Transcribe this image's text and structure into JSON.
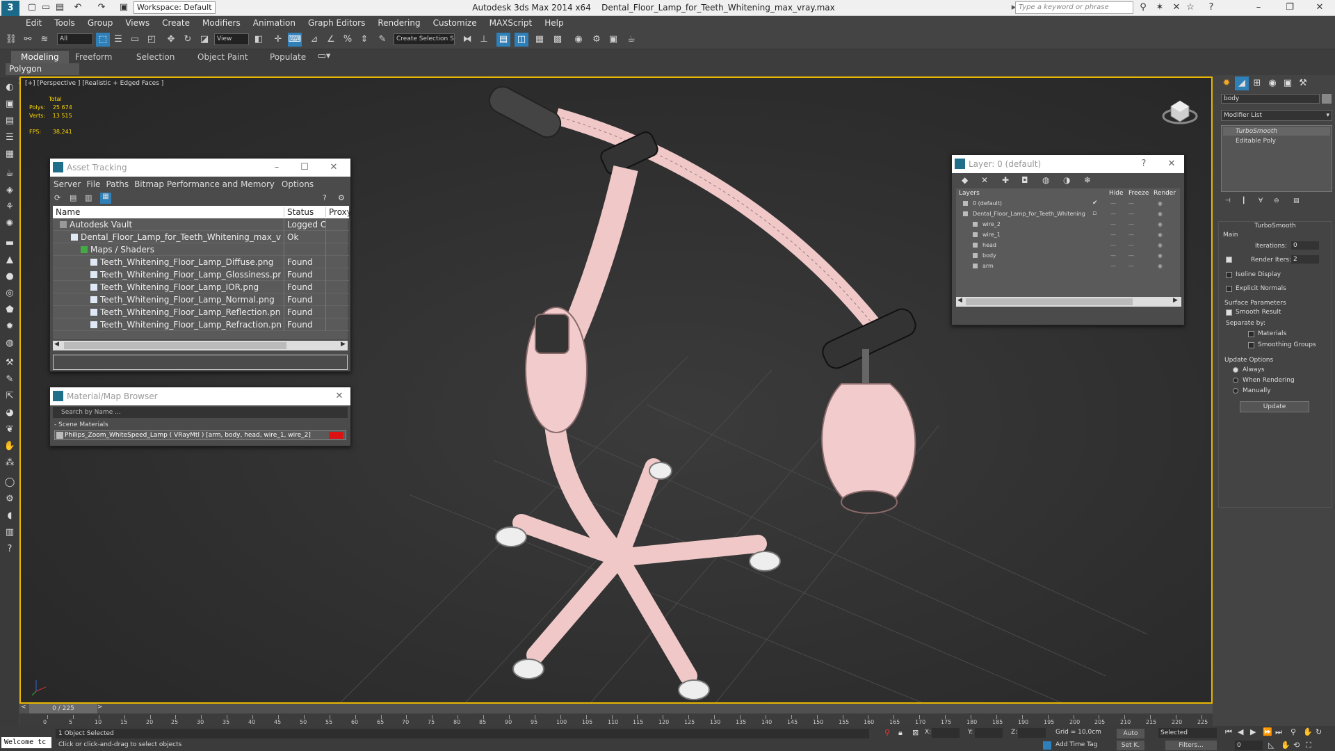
{
  "titlebar": {
    "workspace": "Workspace: Default",
    "app": "Autodesk 3ds Max  2014 x64",
    "file": "Dental_Floor_Lamp_for_Teeth_Whitening_max_vray.max",
    "search_placeholder": "Type a keyword or phrase"
  },
  "menu": [
    "Edit",
    "Tools",
    "Group",
    "Views",
    "Create",
    "Modifiers",
    "Animation",
    "Graph Editors",
    "Rendering",
    "Customize",
    "MAXScript",
    "Help"
  ],
  "toolbar": {
    "selection_filter": "All",
    "ref_coord": "View",
    "named_selection": "Create Selection S"
  },
  "ribbon": {
    "tabs": [
      "Modeling",
      "Freeform",
      "Selection",
      "Object Paint",
      "Populate"
    ],
    "active_tab": "Modeling",
    "sub_label": "Polygon Modeling"
  },
  "viewport": {
    "label": "[+] [Perspective ] [Realistic + Edged Faces ]",
    "total_label": "Total",
    "polys_label": "Polys:",
    "polys_value": "25 674",
    "verts_label": "Verts:",
    "verts_value": "13 515",
    "fps_label": "FPS:",
    "fps_value": "38,241"
  },
  "asset_tracking": {
    "title": "Asset Tracking",
    "menu": [
      "Server",
      "File",
      "Paths",
      "Bitmap Performance and Memory",
      "Options"
    ],
    "columns": [
      "Name",
      "Status",
      "Proxy"
    ],
    "rows": [
      {
        "name": "Autodesk Vault",
        "status": "Logged O..."
      },
      {
        "name": "Dental_Floor_Lamp_for_Teeth_Whitening_max_vray.max",
        "status": "Ok"
      },
      {
        "name": "Maps / Shaders",
        "status": ""
      },
      {
        "name": "Teeth_Whitening_Floor_Lamp_Diffuse.png",
        "status": "Found"
      },
      {
        "name": "Teeth_Whitening_Floor_Lamp_Glossiness.png",
        "status": "Found"
      },
      {
        "name": "Teeth_Whitening_Floor_Lamp_IOR.png",
        "status": "Found"
      },
      {
        "name": "Teeth_Whitening_Floor_Lamp_Normal.png",
        "status": "Found"
      },
      {
        "name": "Teeth_Whitening_Floor_Lamp_Reflection.png",
        "status": "Found"
      },
      {
        "name": "Teeth_Whitening_Floor_Lamp_Refraction.png",
        "status": "Found"
      }
    ]
  },
  "material_browser": {
    "title": "Material/Map Browser",
    "search_placeholder": "Search by Name ...",
    "section": "- Scene Materials",
    "material": "Philips_Zoom_WhiteSpeed_Lamp  ( VRayMtl ) [arm, body, head, wire_1, wire_2]"
  },
  "layer_window": {
    "title": "Layer: 0 (default)",
    "columns": [
      "Layers",
      "Hide",
      "Freeze",
      "Render"
    ],
    "rows": [
      "0 (default)",
      "Dental_Floor_Lamp_for_Teeth_Whitening",
      "wire_2",
      "wire_1",
      "head",
      "body",
      "arm"
    ]
  },
  "command_panel": {
    "object_name": "body",
    "modifier_list": "Modifier List",
    "stack": [
      "TurboSmooth",
      "Editable Poly"
    ],
    "rollout": "TurboSmooth",
    "main": "Main",
    "iterations_label": "Iterations:",
    "iterations_value": "0",
    "render_iters_label": "Render Iters:",
    "render_iters_value": "2",
    "isoline": "Isoline Display",
    "explicit": "Explicit Normals",
    "surface": "Surface Parameters",
    "smooth_result": "Smooth Result",
    "separate_by": "Separate by:",
    "materials": "Materials",
    "smoothing_groups": "Smoothing Groups",
    "update_options": "Update Options",
    "always": "Always",
    "when_rendering": "When Rendering",
    "manually": "Manually",
    "update": "Update"
  },
  "timeline": {
    "frame": "0 / 225",
    "ticks": [
      "0",
      "5",
      "10",
      "15",
      "20",
      "25",
      "30",
      "35",
      "40",
      "45",
      "50",
      "55",
      "60",
      "65",
      "70",
      "75",
      "80",
      "85",
      "90",
      "95",
      "100",
      "105",
      "110",
      "115",
      "120",
      "125",
      "130",
      "135",
      "140",
      "145",
      "150",
      "155",
      "160",
      "165",
      "170",
      "175",
      "180",
      "185",
      "190",
      "195",
      "200",
      "205",
      "210",
      "215",
      "220",
      "225"
    ]
  },
  "status": {
    "welcome": "Welcome tc",
    "selected": "1 Object Selected",
    "prompt": "Click or click-and-drag to select objects",
    "x_label": "X:",
    "y_label": "Y:",
    "z_label": "Z:",
    "grid": "Grid = 10,0cm",
    "add_time_tag": "Add Time Tag",
    "auto": "Auto",
    "set_key": "Set K.",
    "key_mode": "Selected",
    "filters": "Filters...",
    "frame_value": "0"
  },
  "colors": {
    "accent": "#2f7fb8",
    "viewport_border": "#e8b600",
    "mesh": "#f0c8c8",
    "stats": "#ffd700"
  }
}
